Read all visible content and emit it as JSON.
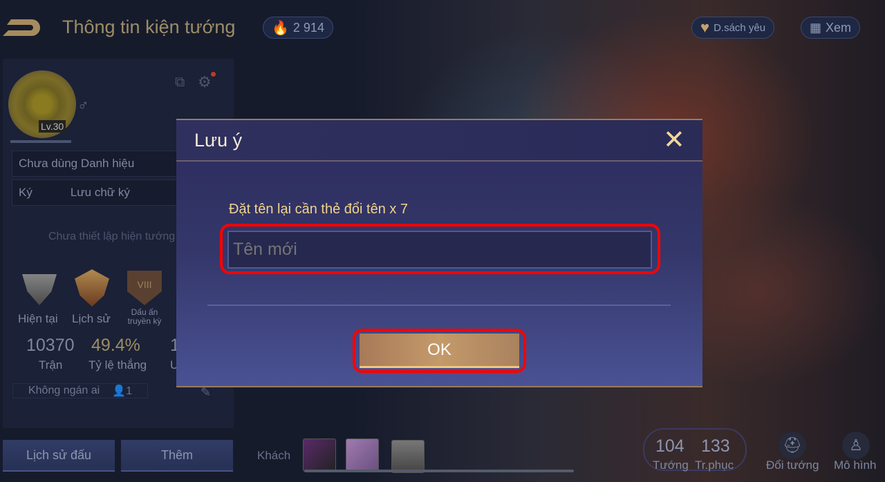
{
  "header": {
    "title": "Thông tin kiện tướng",
    "currency": "2 914",
    "favorites_label": "D.sách yêu",
    "view_label": "Xem"
  },
  "profile": {
    "level": "Lv.30",
    "title_row": "Chưa dùng Danh hiệu",
    "signature_label": "Ký",
    "signature_value": "Lưu chữ ký",
    "hero_unset": "Chưa thiết lập hiện tướng",
    "ranks": [
      {
        "label": "Hiện tại"
      },
      {
        "label": "Lịch sử"
      },
      {
        "label": "Dấu ấn truyền kỳ",
        "badge": "VIII"
      }
    ],
    "stats": [
      {
        "value": "10370",
        "label": "Trận"
      },
      {
        "value": "49.4%",
        "label": "Tỷ lệ thắng"
      },
      {
        "value": "1",
        "label": "U"
      }
    ],
    "relation": "Không ngán ai",
    "relation_count": "1"
  },
  "bottom": {
    "match_history": "Lịch sử đấu",
    "more": "Thêm",
    "guests": "Khách",
    "heroes_count": "104",
    "heroes_label": "Tướng",
    "skins_count": "133",
    "skins_label": "Tr.phục",
    "change_hero": "Đổi tướng",
    "model": "Mô hình"
  },
  "dialog": {
    "title": "Lưu ý",
    "message": "Đặt tên lại cần thẻ đổi tên x 7",
    "input_placeholder": "Tên mới",
    "ok_label": "OK"
  },
  "colors": {
    "highlight": "#ff0000",
    "dialog_accent": "#f2d48a"
  }
}
